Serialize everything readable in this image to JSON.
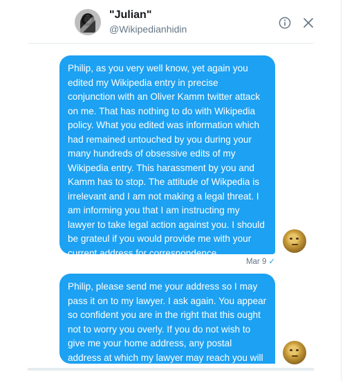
{
  "header": {
    "name": "\"Julian\"",
    "handle": "@Wikipedianhidin"
  },
  "icons": {
    "info": "info-circle-icon",
    "close": "close-icon"
  },
  "messages": [
    {
      "text": "Philip, as you very well know, yet again you edited my Wikipedia entry in precise conjunction with an Oliver Kamm twitter attack on me. That has nothing to do with Wikipedia policy. What you edited was information which had remained untouched by you during your many hundreds of obsessive edits of my Wikipedia entry. This harassment by you and Kamm has to stop. The attitude of Wikpedia is irrelevant and I am not making a legal threat. I am informing you that I am instructing my lawyer to take legal action against you. I should be grateul if you would provide me with your current address for correspondence.",
      "date": "Mar 9",
      "status_icon": "check-icon"
    },
    {
      "text": "Philip, please send me your address so I may pass it on to my lawyer. I ask again. You appear so confident you are in the right that this ought not to worry you overly. If you do not wish to give me your home address, any postal address at which my lawyer may reach you will suffice."
    }
  ],
  "colors": {
    "bubble": "#1da1f2",
    "secondary_text": "#657786"
  }
}
